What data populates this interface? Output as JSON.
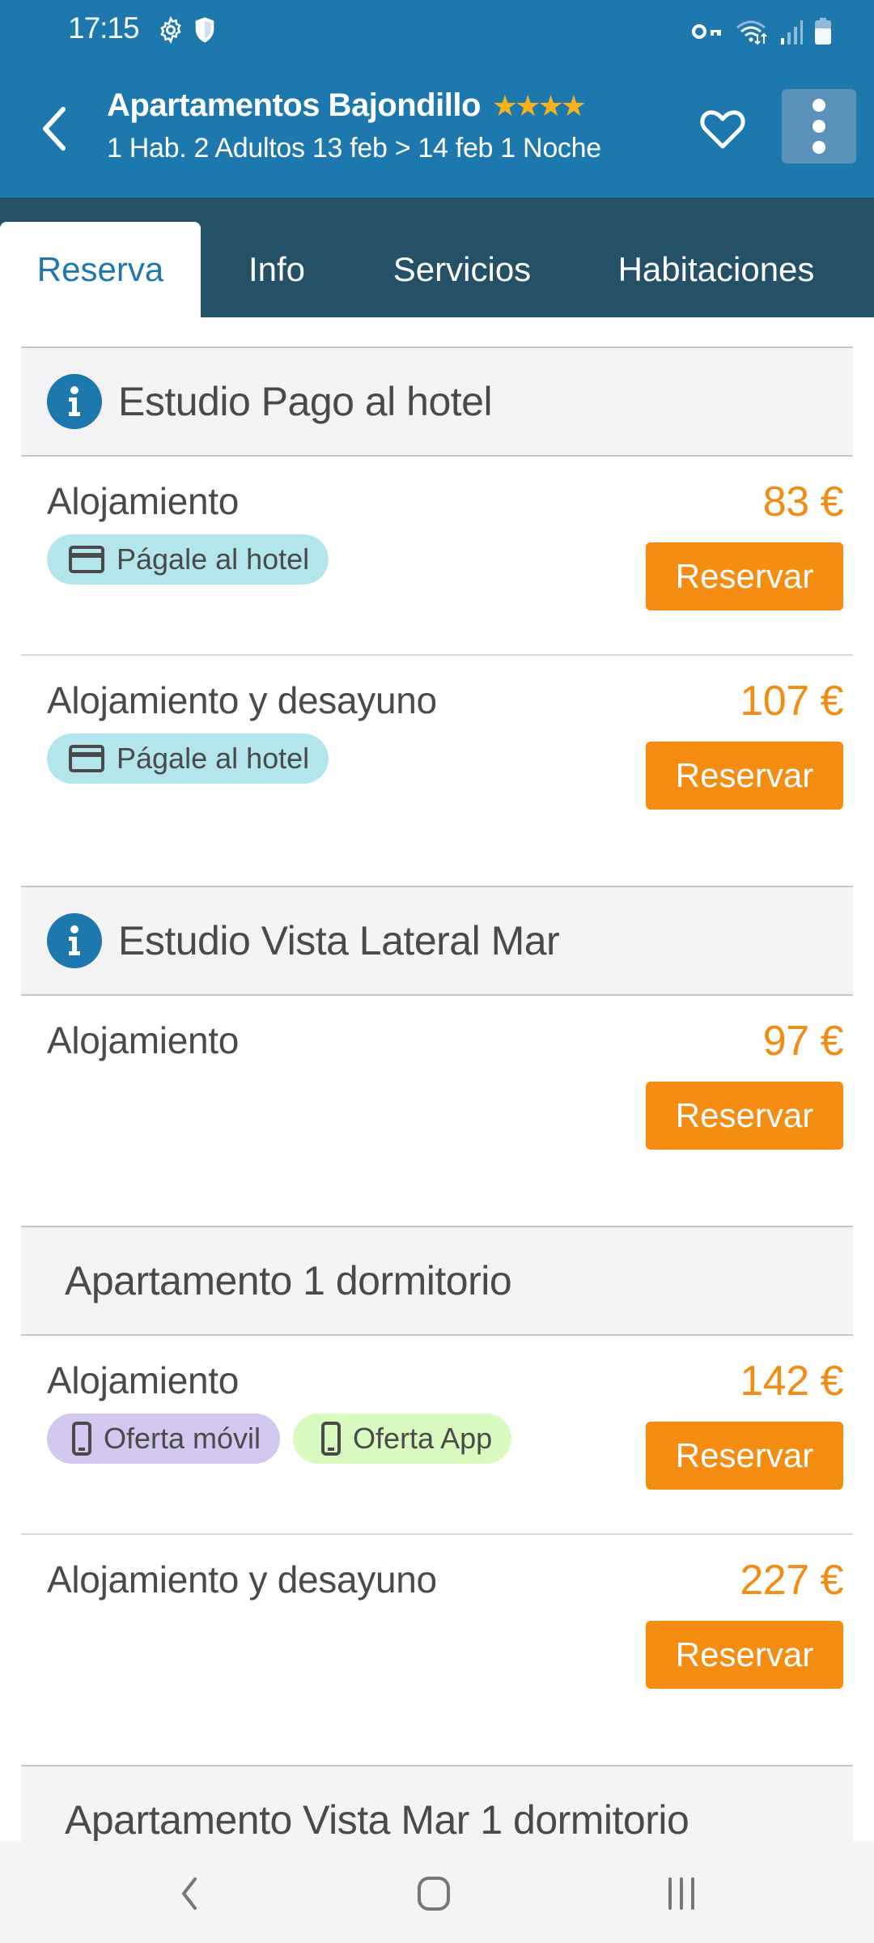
{
  "status_bar": {
    "time": "17:15",
    "left_icons": [
      "gear-icon",
      "shield-icon"
    ],
    "right_icons": [
      "key-icon",
      "wifi-icon",
      "signal-icon",
      "battery-icon"
    ]
  },
  "header": {
    "title": "Apartamentos Bajondillo",
    "stars": "★★★★",
    "star_count": 4,
    "subtitle": "1 Hab. 2 Adultos 13 feb > 14 feb 1 Noche",
    "colors": {
      "bar": "#1d78ae",
      "star": "#f8b11b"
    }
  },
  "tabs": [
    {
      "label": "Reserva",
      "active": true
    },
    {
      "label": "Info",
      "active": false
    },
    {
      "label": "Servicios",
      "active": false
    },
    {
      "label": "Habitaciones",
      "active": false
    }
  ],
  "sections": [
    {
      "title": "Estudio Pago al hotel",
      "has_info_icon": true,
      "rates": [
        {
          "name": "Alojamiento",
          "price": "83 €",
          "button": "Reservar",
          "badges": [
            {
              "label": "Págale al hotel",
              "icon": "credit-card-icon",
              "color": "#b3e6ec"
            }
          ]
        },
        {
          "name": "Alojamiento y desayuno",
          "price": "107 €",
          "button": "Reservar",
          "badges": [
            {
              "label": "Págale al hotel",
              "icon": "credit-card-icon",
              "color": "#b3e6ec"
            }
          ]
        }
      ]
    },
    {
      "title": "Estudio Vista Lateral Mar",
      "has_info_icon": true,
      "rates": [
        {
          "name": "Alojamiento",
          "price": "97 €",
          "button": "Reservar",
          "badges": []
        }
      ]
    },
    {
      "title": "Apartamento 1 dormitorio",
      "has_info_icon": false,
      "rates": [
        {
          "name": "Alojamiento",
          "price": "142 €",
          "button": "Reservar",
          "badges": [
            {
              "label": "Oferta móvil",
              "icon": "smartphone-icon",
              "color": "#d2c8f0"
            },
            {
              "label": "Oferta App",
              "icon": "smartphone-icon",
              "color": "#d9fbbf"
            }
          ]
        },
        {
          "name": "Alojamiento y desayuno",
          "price": "227 €",
          "button": "Reservar",
          "badges": []
        }
      ]
    },
    {
      "title": "Apartamento Vista Mar 1 dormitorio",
      "has_info_icon": false,
      "rates": []
    }
  ],
  "colors": {
    "price": "#f28c12",
    "button": "#f48d11",
    "tabbar": "#245167"
  },
  "nav_bar": [
    "back-nav-icon",
    "home-nav-icon",
    "recents-nav-icon"
  ]
}
